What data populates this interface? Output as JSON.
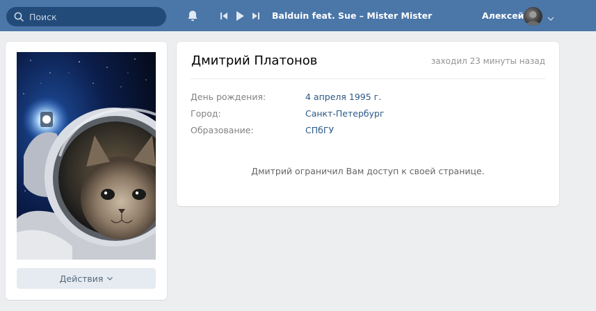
{
  "header": {
    "search": {
      "placeholder": "Поиск",
      "icon": "search-icon"
    },
    "notifications_icon": "bell-icon",
    "player": {
      "prev_icon": "previous-track-icon",
      "play_icon": "play-icon",
      "next_icon": "next-track-icon",
      "track": "Balduin feat. Sue – Mister Mister"
    },
    "user": {
      "name": "Алексей",
      "menu_icon": "chevron-down-icon"
    }
  },
  "profile": {
    "photo_description_icon": "profile-photo",
    "actions_label": "Действия",
    "name": "Дмитрий Платонов",
    "last_seen": "заходил 23 минуты назад",
    "fields": [
      {
        "label": "День рождения:",
        "value": "4 апреля 1995 г."
      },
      {
        "label": "Город:",
        "value": "Санкт-Петербург"
      },
      {
        "label": "Образование:",
        "value": "СПбГУ"
      }
    ],
    "restricted_notice": "Дмитрий ограничил Вам доступ к своей странице."
  },
  "colors": {
    "header_bg": "#4a76a8",
    "search_bg": "#224b7a",
    "page_bg": "#edeef0",
    "link": "#2a5885",
    "button_bg": "#e5ebf1"
  }
}
